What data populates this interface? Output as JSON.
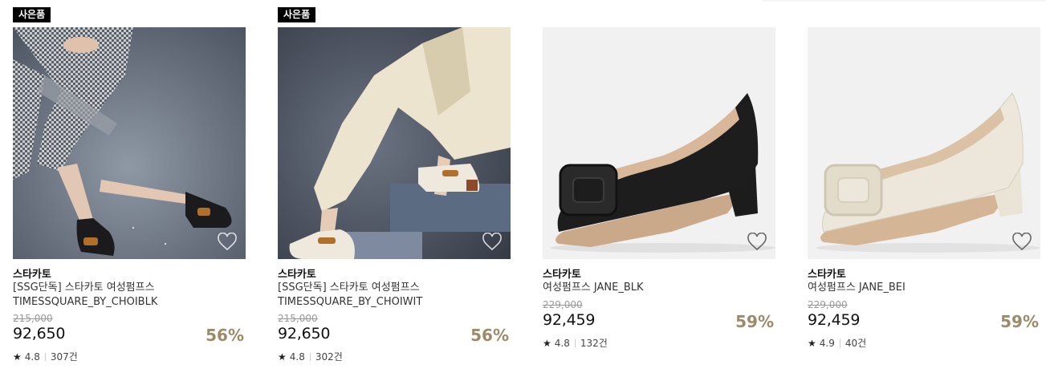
{
  "products": [
    {
      "badge": "사은품",
      "brand": "스타카토",
      "title": "[SSG단독] 스타카토 여성펌프스 TIMESSQUARE_BY_CHOIBLK",
      "original_price": "215,000",
      "price": "92,650",
      "discount": "56%",
      "rating": "4.8",
      "reviews": "307건",
      "image": "lifestyle-black-loafer"
    },
    {
      "badge": "사은품",
      "brand": "스타카토",
      "title": "[SSG단독] 스타카토 여성펌프스 TIMESSQUARE_BY_CHOIWIT",
      "original_price": "215,000",
      "price": "92,650",
      "discount": "56%",
      "rating": "4.8",
      "reviews": "302건",
      "image": "lifestyle-white-loafer"
    },
    {
      "brand": "스타카토",
      "title": "여성펌프스 JANE_BLK",
      "original_price": "229,000",
      "price": "92,459",
      "discount": "59%",
      "rating": "4.8",
      "reviews": "132건",
      "image": "black-pump"
    },
    {
      "brand": "스타카토",
      "title": "여성펌프스 JANE_BEI",
      "original_price": "229,000",
      "price": "92,459",
      "discount": "59%",
      "rating": "4.9",
      "reviews": "40건",
      "image": "beige-pump"
    }
  ],
  "colors": {
    "discount": "#9c8a68",
    "badge_bg": "#000000",
    "strike": "#999999"
  },
  "icons": {
    "wishlist": "heart-outline-icon",
    "rating": "star-icon"
  }
}
